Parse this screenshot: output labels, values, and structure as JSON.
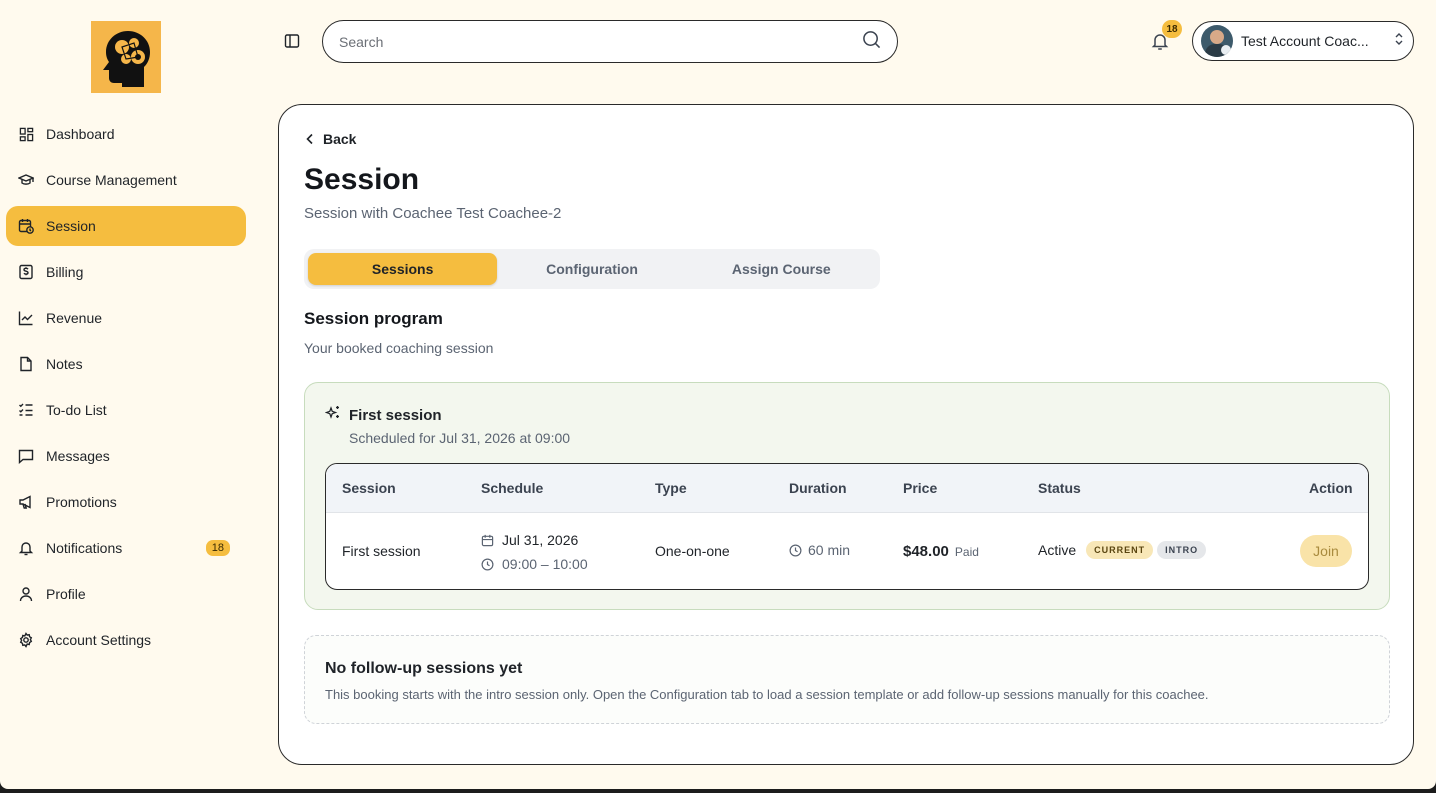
{
  "sidebar": {
    "items": [
      {
        "label": "Dashboard",
        "icon": "dashboard-icon"
      },
      {
        "label": "Course Management",
        "icon": "graduation-cap-icon"
      },
      {
        "label": "Session",
        "icon": "calendar-clock-icon",
        "active": true
      },
      {
        "label": "Billing",
        "icon": "dollar-receipt-icon"
      },
      {
        "label": "Revenue",
        "icon": "chart-line-icon"
      },
      {
        "label": "Notes",
        "icon": "file-icon"
      },
      {
        "label": "To-do List",
        "icon": "list-checks-icon"
      },
      {
        "label": "Messages",
        "icon": "message-square-icon"
      },
      {
        "label": "Promotions",
        "icon": "megaphone-icon"
      },
      {
        "label": "Notifications",
        "icon": "bell-icon",
        "badge": "18"
      },
      {
        "label": "Profile",
        "icon": "user-icon"
      },
      {
        "label": "Account Settings",
        "icon": "gear-icon"
      }
    ]
  },
  "topbar": {
    "search_placeholder": "Search",
    "notification_count": "18",
    "account_name": "Test Account Coac..."
  },
  "main": {
    "back_label": "Back",
    "title": "Session",
    "subtitle": "Session with Coachee Test Coachee-2",
    "tabs": [
      "Sessions",
      "Configuration",
      "Assign Course"
    ],
    "active_tab": 0,
    "section_title": "Session program",
    "section_subtitle": "Your booked coaching session",
    "session_card": {
      "title": "First session",
      "scheduled": "Scheduled for Jul 31, 2026 at 09:00",
      "columns": [
        "Session",
        "Schedule",
        "Type",
        "Duration",
        "Price",
        "Status",
        "Action"
      ],
      "row": {
        "session": "First session",
        "date": "Jul 31, 2026",
        "time": "09:00 – 10:00",
        "type": "One-on-one",
        "duration": "60 min",
        "price": "$48.00",
        "paid": "Paid",
        "status": "Active",
        "tag_current": "CURRENT",
        "tag_intro": "INTRO",
        "action": "Join"
      }
    },
    "followup": {
      "title": "No follow-up sessions yet",
      "text": "This booking starts with the intro session only. Open the Configuration tab to load a session template or add follow-up sessions manually for this coachee."
    }
  },
  "colors": {
    "accent": "#f5bd3f",
    "background": "#fffaee",
    "card_green": "#f3f7ee"
  }
}
